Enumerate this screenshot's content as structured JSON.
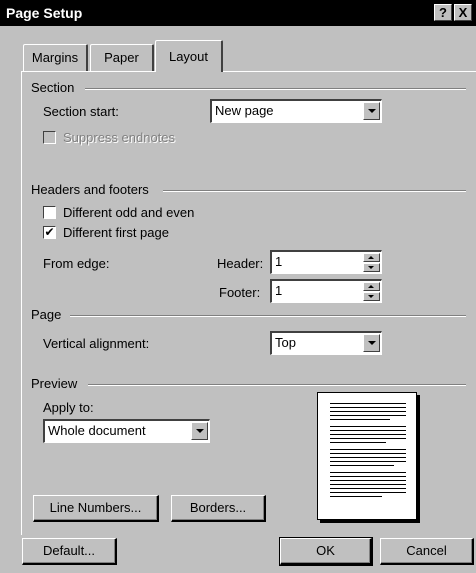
{
  "window": {
    "title": "Page Setup",
    "help_label": "?",
    "close_label": "X"
  },
  "tabs": [
    {
      "label": "Margins",
      "active": false
    },
    {
      "label": "Paper",
      "active": false
    },
    {
      "label": "Layout",
      "active": true
    }
  ],
  "section": {
    "heading": "Section",
    "start_label": "Section start:",
    "start_value": "New page",
    "suppress_endnotes_label": "Suppress endnotes",
    "suppress_endnotes_checked": false
  },
  "headers_footers": {
    "heading": "Headers and footers",
    "odd_even_label": "Different odd and even",
    "odd_even_checked": false,
    "first_page_label": "Different first page",
    "first_page_checked": true,
    "from_edge_label": "From edge:",
    "header_label": "Header:",
    "header_value": "1",
    "footer_label": "Footer:",
    "footer_value": "1"
  },
  "page": {
    "heading": "Page",
    "vertical_alignment_label": "Vertical alignment:",
    "vertical_alignment_value": "Top"
  },
  "preview": {
    "heading": "Preview",
    "apply_to_label": "Apply to:",
    "apply_to_value": "Whole document"
  },
  "buttons": {
    "line_numbers": "Line Numbers...",
    "borders": "Borders...",
    "default": "Default...",
    "ok": "OK",
    "cancel": "Cancel"
  },
  "checkmark": "✔",
  "colors": {
    "face": "#c0c0c0",
    "titlebar": "#000000",
    "disabled_text": "#808080"
  }
}
